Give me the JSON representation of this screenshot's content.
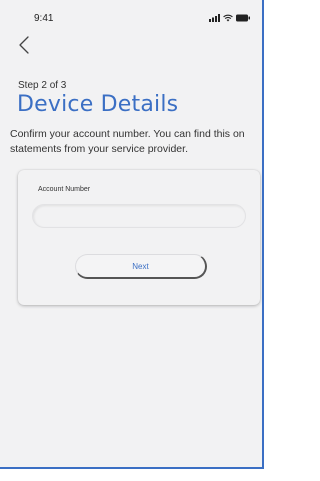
{
  "status_bar": {
    "time": "9:41"
  },
  "header": {
    "back_icon": "chevron-left-icon"
  },
  "step": {
    "label": "Step 2 of 3"
  },
  "title": "Device Details",
  "description": "Confirm your account number. You can find this on statements from your service provider.",
  "form": {
    "account_label": "Account Number",
    "account_value": "",
    "next_label": "Next"
  },
  "colors": {
    "accent": "#3b6fc4",
    "background": "#f2f2f3"
  }
}
